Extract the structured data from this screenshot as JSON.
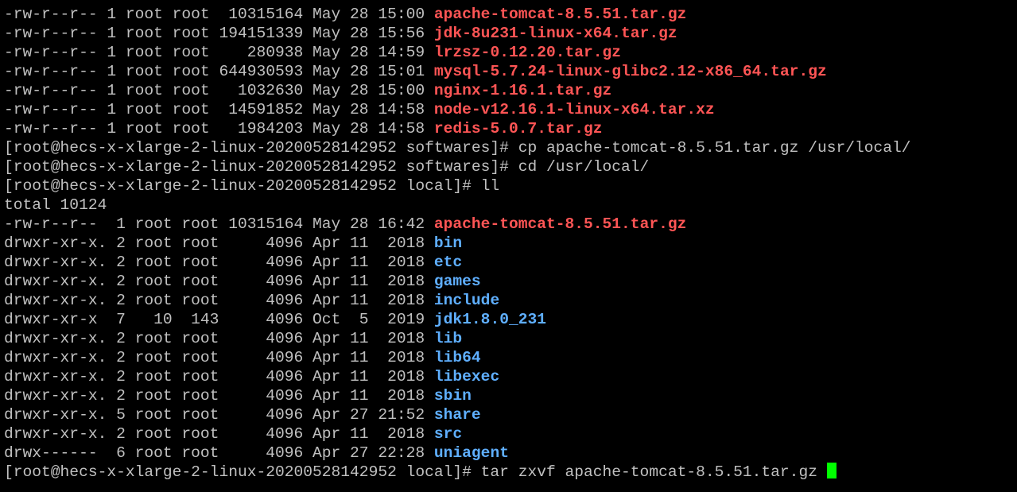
{
  "terminal": {
    "colors": {
      "background": "#000000",
      "text": "#c0c0c0",
      "archive": "#ff5555",
      "directory": "#5fafff",
      "cursor": "#00ff00"
    },
    "lines": [
      {
        "kind": "file",
        "prefix": "-rw-r--r-- 1 root root  10315164 May 28 15:00 ",
        "name": "apache-tomcat-8.5.51.tar.gz",
        "color": "archive"
      },
      {
        "kind": "file",
        "prefix": "-rw-r--r-- 1 root root 194151339 May 28 15:56 ",
        "name": "jdk-8u231-linux-x64.tar.gz",
        "color": "archive"
      },
      {
        "kind": "file",
        "prefix": "-rw-r--r-- 1 root root    280938 May 28 14:59 ",
        "name": "lrzsz-0.12.20.tar.gz",
        "color": "archive"
      },
      {
        "kind": "file",
        "prefix": "-rw-r--r-- 1 root root 644930593 May 28 15:01 ",
        "name": "mysql-5.7.24-linux-glibc2.12-x86_64.tar.gz",
        "color": "archive"
      },
      {
        "kind": "file",
        "prefix": "-rw-r--r-- 1 root root   1032630 May 28 15:00 ",
        "name": "nginx-1.16.1.tar.gz",
        "color": "archive"
      },
      {
        "kind": "file",
        "prefix": "-rw-r--r-- 1 root root  14591852 May 28 14:58 ",
        "name": "node-v12.16.1-linux-x64.tar.xz",
        "color": "archive"
      },
      {
        "kind": "file",
        "prefix": "-rw-r--r-- 1 root root   1984203 May 28 14:58 ",
        "name": "redis-5.0.7.tar.gz",
        "color": "archive"
      },
      {
        "kind": "text",
        "text": "[root@hecs-x-xlarge-2-linux-20200528142952 softwares]# cp apache-tomcat-8.5.51.tar.gz /usr/local/"
      },
      {
        "kind": "text",
        "text": "[root@hecs-x-xlarge-2-linux-20200528142952 softwares]# cd /usr/local/"
      },
      {
        "kind": "text",
        "text": "[root@hecs-x-xlarge-2-linux-20200528142952 local]# ll"
      },
      {
        "kind": "text",
        "text": "total 10124"
      },
      {
        "kind": "file",
        "prefix": "-rw-r--r--  1 root root 10315164 May 28 16:42 ",
        "name": "apache-tomcat-8.5.51.tar.gz",
        "color": "archive"
      },
      {
        "kind": "file",
        "prefix": "drwxr-xr-x. 2 root root     4096 Apr 11  2018 ",
        "name": "bin",
        "color": "directory"
      },
      {
        "kind": "file",
        "prefix": "drwxr-xr-x. 2 root root     4096 Apr 11  2018 ",
        "name": "etc",
        "color": "directory"
      },
      {
        "kind": "file",
        "prefix": "drwxr-xr-x. 2 root root     4096 Apr 11  2018 ",
        "name": "games",
        "color": "directory"
      },
      {
        "kind": "file",
        "prefix": "drwxr-xr-x. 2 root root     4096 Apr 11  2018 ",
        "name": "include",
        "color": "directory"
      },
      {
        "kind": "file",
        "prefix": "drwxr-xr-x  7   10  143     4096 Oct  5  2019 ",
        "name": "jdk1.8.0_231",
        "color": "directory"
      },
      {
        "kind": "file",
        "prefix": "drwxr-xr-x. 2 root root     4096 Apr 11  2018 ",
        "name": "lib",
        "color": "directory"
      },
      {
        "kind": "file",
        "prefix": "drwxr-xr-x. 2 root root     4096 Apr 11  2018 ",
        "name": "lib64",
        "color": "directory"
      },
      {
        "kind": "file",
        "prefix": "drwxr-xr-x. 2 root root     4096 Apr 11  2018 ",
        "name": "libexec",
        "color": "directory"
      },
      {
        "kind": "file",
        "prefix": "drwxr-xr-x. 2 root root     4096 Apr 11  2018 ",
        "name": "sbin",
        "color": "directory"
      },
      {
        "kind": "file",
        "prefix": "drwxr-xr-x. 5 root root     4096 Apr 27 21:52 ",
        "name": "share",
        "color": "directory"
      },
      {
        "kind": "file",
        "prefix": "drwxr-xr-x. 2 root root     4096 Apr 11  2018 ",
        "name": "src",
        "color": "directory"
      },
      {
        "kind": "file",
        "prefix": "drwx------  6 root root     4096 Apr 27 22:28 ",
        "name": "uniagent",
        "color": "directory"
      },
      {
        "kind": "prompt",
        "text": "[root@hecs-x-xlarge-2-linux-20200528142952 local]# tar zxvf apache-tomcat-8.5.51.tar.gz "
      }
    ]
  }
}
